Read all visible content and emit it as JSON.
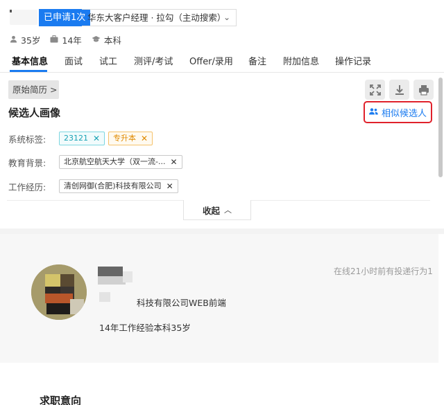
{
  "header": {
    "apply_badge": "已申请1次",
    "job_title": "华东大客户经理 · 拉勾（主动搜索）",
    "caret": "⌄",
    "meta": {
      "age": "35岁",
      "experience": "14年",
      "education": "本科"
    }
  },
  "tabs": [
    "基本信息",
    "面试",
    "试工",
    "测评/考试",
    "Offer/录用",
    "备注",
    "附加信息",
    "操作记录"
  ],
  "active_tab": "基本信息",
  "portrait": {
    "resume_button": "原始简历 >",
    "title": "候选人画像",
    "similar_button": "相似候选人",
    "rows": [
      {
        "label": "系统标签:",
        "tags": [
          "23121",
          "专升本"
        ]
      },
      {
        "label": "教育背景:",
        "tags": [
          "北京航空航天大学（双一流-..."
        ]
      },
      {
        "label": "工作经历:",
        "tags": [
          "清创网御(合肥)科技有限公司"
        ]
      }
    ],
    "collapse_button": "收起"
  },
  "profile": {
    "online_status": "在线21小时前有投递行为1",
    "company_line": "科技有限公司WEB前端",
    "summary": "14年工作经验本科35岁"
  },
  "job_intent_title": "求职意向",
  "icons": {
    "expand": "expand-icon",
    "download": "download-icon",
    "print": "print-icon",
    "person": "person-icon",
    "briefcase": "briefcase-icon",
    "graduation": "graduation-cap-icon",
    "users": "users-icon"
  },
  "colors": {
    "primary": "#1a7bf0",
    "highlight_border": "#e0212b",
    "tag_cyan": "#1aa3b5",
    "tag_orange": "#e08a00"
  }
}
